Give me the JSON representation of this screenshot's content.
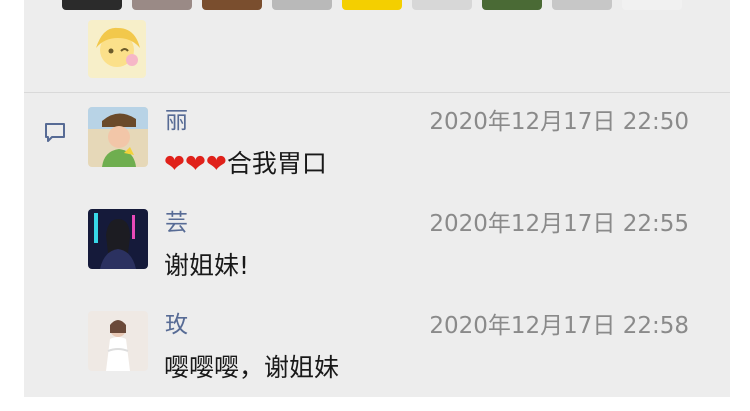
{
  "moments": {
    "top_avatar_colors": [
      "#2b2b2b",
      "#9a8a86",
      "#7a4e2e",
      "#b9b9b9",
      "#f4cf00",
      "#d7d7d7",
      "#4a6a35",
      "#c7c7c7",
      "#f1f1f1"
    ],
    "comments": [
      {
        "name": "丽",
        "time": "2020年12月17日 22:50",
        "text_prefix": "❤❤❤",
        "text": "合我胃口"
      },
      {
        "name": "芸",
        "time": "2020年12月17日 22:55",
        "text_prefix": "",
        "text": "谢姐妹!"
      },
      {
        "name": "玫",
        "time": "2020年12月17日 22:58",
        "text_prefix": "",
        "text": "嘤嘤嘤，谢姐妹"
      }
    ]
  }
}
